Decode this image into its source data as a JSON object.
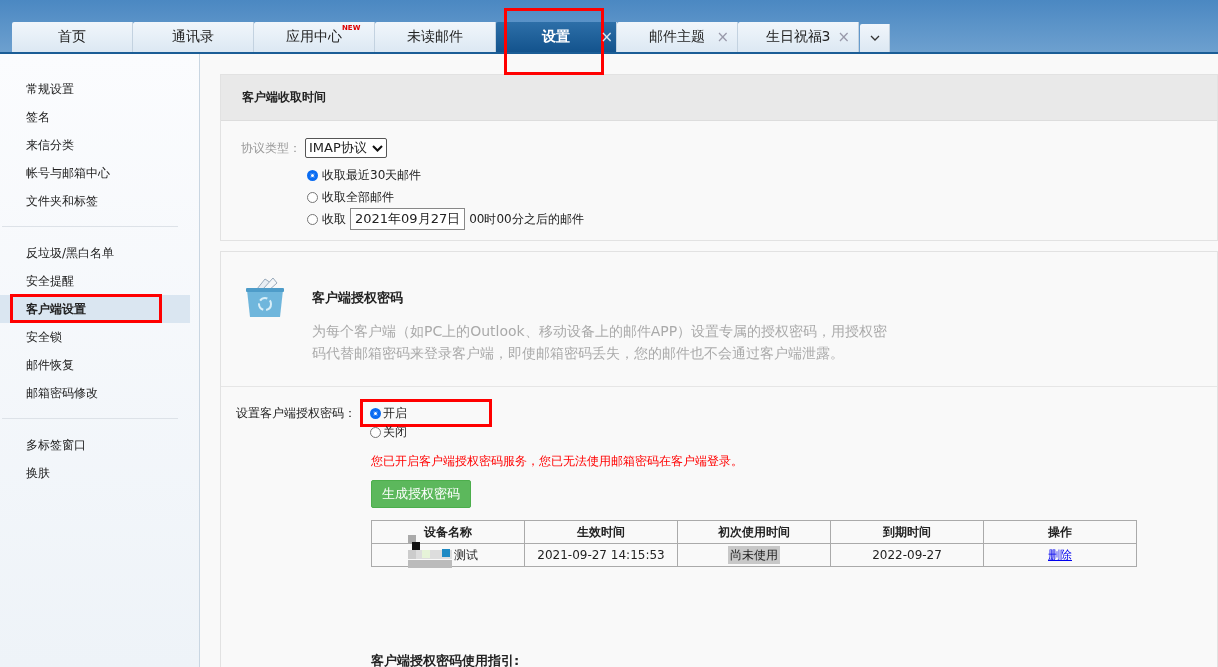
{
  "tabs": [
    {
      "label": "首页",
      "selected": false
    },
    {
      "label": "通讯录",
      "selected": false
    },
    {
      "label": "应用中心",
      "selected": false,
      "badge": "NEW"
    },
    {
      "label": "未读邮件",
      "selected": false
    },
    {
      "label": "设置",
      "selected": true,
      "close": "×",
      "highlighted": true
    },
    {
      "label": "邮件主题",
      "selected": false,
      "close": "×"
    },
    {
      "label": "生日祝福3",
      "selected": false,
      "close": "×"
    }
  ],
  "sidebar": {
    "groups": [
      [
        {
          "label": "常规设置",
          "selected": false
        },
        {
          "label": "签名",
          "selected": false
        },
        {
          "label": "来信分类",
          "selected": false
        },
        {
          "label": "帐号与邮箱中心",
          "selected": false
        },
        {
          "label": "文件夹和标签",
          "selected": false
        }
      ],
      [
        {
          "label": "反垃圾/黑白名单",
          "selected": false
        },
        {
          "label": "安全提醒",
          "selected": false
        },
        {
          "label": "客户端设置",
          "selected": true,
          "highlighted": true
        },
        {
          "label": "安全锁",
          "selected": false
        },
        {
          "label": "邮件恢复",
          "selected": false
        },
        {
          "label": "邮箱密码修改",
          "selected": false
        }
      ],
      [
        {
          "label": "多标签窗口",
          "selected": false
        },
        {
          "label": "换肤",
          "selected": false
        }
      ]
    ]
  },
  "fetch_section": {
    "title": "客户端收取时间",
    "protocol_label": "协议类型：",
    "protocol_value": "IMAP协议",
    "options": [
      {
        "kind": "plain",
        "label": "收取最近30天邮件",
        "selected": true
      },
      {
        "kind": "plain",
        "label": "收取全部邮件",
        "selected": false
      },
      {
        "kind": "date",
        "label": "收取",
        "date": "2021年09月27日",
        "suffix": "00时00分之后的邮件",
        "selected": false
      }
    ]
  },
  "auth_section": {
    "title": "客户端授权密码",
    "description": "为每个客户端（如PC上的Outlook、移动设备上的邮件APP）设置专属的授权密码，用授权密码代替邮箱密码来登录客户端，即使邮箱密码丢失，您的邮件也不会通过客户端泄露。",
    "setting_label": "设置客户端授权密码：",
    "switch": [
      {
        "label": "开启",
        "selected": true,
        "highlighted": true
      },
      {
        "label": "关闭",
        "selected": false
      }
    ],
    "notice": "您已开启客户端授权密码服务，您已无法使用邮箱密码在客户端登录。",
    "generate_button": "生成授权密码",
    "table": {
      "columns": [
        "设备名称",
        "生效时间",
        "初次使用时间",
        "到期时间",
        "操作"
      ],
      "rows": [
        {
          "device": "测试",
          "start": "2021-09-27 14:15:53",
          "first_use": "尚未使用",
          "expires": "2022-09-27",
          "action": "删除"
        }
      ]
    },
    "guide_title": "客户端授权密码使用指引:"
  }
}
